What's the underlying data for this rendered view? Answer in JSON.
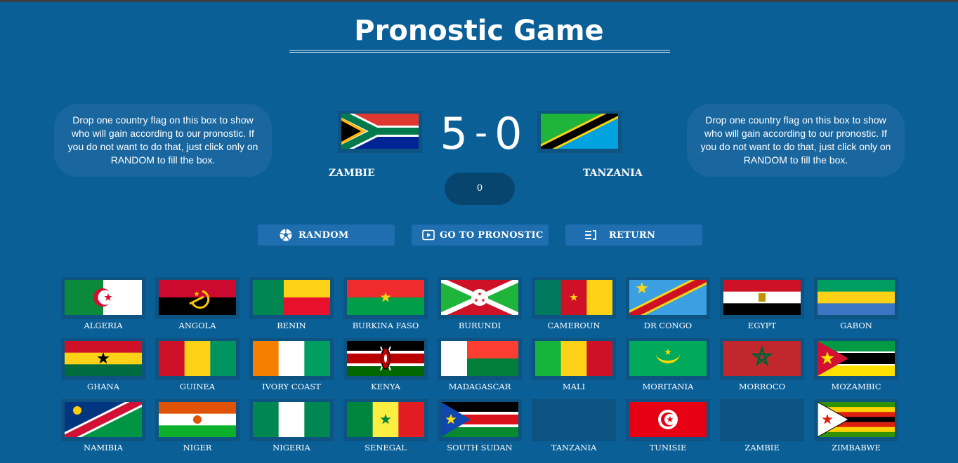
{
  "header": {
    "title": "Pronostic Game"
  },
  "match": {
    "hint_left": "Drop one country flag on this box to show who will gain according to our pronostic. If you do not want to do that, just click only on RANDOM to fill the box.",
    "hint_right": "Drop one country flag on this box to show who will gain according to our pronostic. If you do not want to do that, just click only on RANDOM to fill the box.",
    "home_team": "ZAMBIE",
    "away_team": "TANZANIA",
    "home_score": "5",
    "score_separator": "-",
    "away_score": "0",
    "counter": "0",
    "home_flag_icon": "south-africa-flag",
    "away_flag_icon": "tanzania-flag"
  },
  "actions": {
    "random": {
      "label": "RANDOM",
      "icon": "soccer-ball-icon"
    },
    "pronostic": {
      "label": "GO TO PRONOSTIC",
      "icon": "play-icon"
    },
    "return": {
      "label": "RETURN",
      "icon": "list-return-icon"
    }
  },
  "countries": [
    {
      "name": "ALGERIA",
      "flag": "algeria"
    },
    {
      "name": "ANGOLA",
      "flag": "angola"
    },
    {
      "name": "BENIN",
      "flag": "benin"
    },
    {
      "name": "BURKINA FASO",
      "flag": "burkina-faso"
    },
    {
      "name": "BURUNDI",
      "flag": "burundi"
    },
    {
      "name": "CAMEROUN",
      "flag": "cameroun"
    },
    {
      "name": "DR CONGO",
      "flag": "dr-congo"
    },
    {
      "name": "EGYPT",
      "flag": "egypt"
    },
    {
      "name": "GABON",
      "flag": "gabon"
    },
    {
      "name": "GHANA",
      "flag": "ghana"
    },
    {
      "name": "GUINEA",
      "flag": "guinea"
    },
    {
      "name": "IVORY COAST",
      "flag": "ivory-coast"
    },
    {
      "name": "KENYA",
      "flag": "kenya"
    },
    {
      "name": "MADAGASCAR",
      "flag": "madagascar"
    },
    {
      "name": "MALI",
      "flag": "mali"
    },
    {
      "name": "MORITANIA",
      "flag": "mauritania"
    },
    {
      "name": "MORROCO",
      "flag": "morocco"
    },
    {
      "name": "MOZAMBIC",
      "flag": "mozambique"
    },
    {
      "name": "NAMIBIA",
      "flag": "namibia"
    },
    {
      "name": "NIGER",
      "flag": "niger"
    },
    {
      "name": "NIGERIA",
      "flag": "nigeria"
    },
    {
      "name": "SENEGAL",
      "flag": "senegal"
    },
    {
      "name": "SOUTH SUDAN",
      "flag": "south-sudan"
    },
    {
      "name": "TANZANIA",
      "flag": "empty"
    },
    {
      "name": "TUNISIE",
      "flag": "tunisia"
    },
    {
      "name": "ZAMBIE",
      "flag": "empty"
    },
    {
      "name": "ZIMBABWE",
      "flag": "zimbabwe"
    }
  ],
  "colors": {
    "background": "#0a5f97",
    "panel": "#1a679f",
    "button": "#1f6fb0",
    "counter": "#08456e"
  }
}
